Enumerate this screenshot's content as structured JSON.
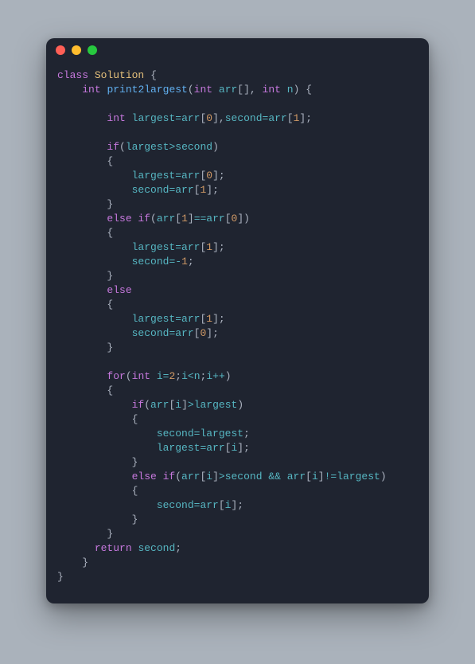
{
  "titlebar": {
    "red": "red",
    "yellow": "yellow",
    "green": "green"
  },
  "code": {
    "t": {
      "class": "class",
      "int": "int",
      "if": "if",
      "else": "else",
      "else_if": "else if",
      "for": "for",
      "return": "return"
    },
    "id": {
      "Solution": "Solution",
      "print2largest": "print2largest",
      "arr": "arr",
      "n": "n",
      "largest": "largest",
      "second": "second",
      "i": "i"
    },
    "num": {
      "0": "0",
      "1": "1",
      "2": "2",
      "neg1": "1"
    },
    "sym": {
      "lbrace": "{",
      "rbrace": "}",
      "lparen": "(",
      "rparen": ")",
      "lbrack": "[",
      "rbrack": "]",
      "comma": ",",
      "semi": ";",
      "eq": "=",
      "eqeq": "==",
      "neq": "!=",
      "gt": ">",
      "lt": "<",
      "minus": "-",
      "pp": "++",
      "andand": "&&",
      "sp": " ",
      "nl": ""
    }
  }
}
